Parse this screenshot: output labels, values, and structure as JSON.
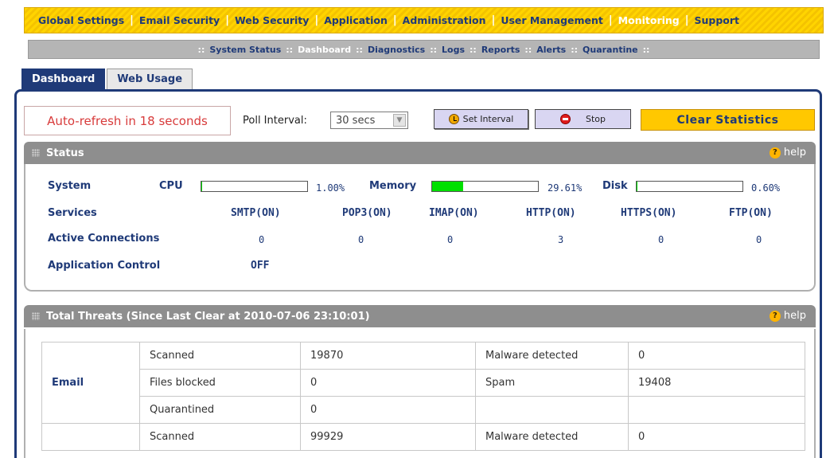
{
  "topnav": {
    "items": [
      "Global Settings",
      "Email Security",
      "Web Security",
      "Application",
      "Administration",
      "User Management",
      "Monitoring",
      "Support"
    ],
    "active_index": 6
  },
  "subnav": {
    "items": [
      "System Status",
      "Dashboard",
      "Diagnostics",
      "Logs",
      "Reports",
      "Alerts",
      "Quarantine"
    ],
    "active_index": 1
  },
  "tabs": [
    "Dashboard",
    "Web Usage"
  ],
  "toolbar": {
    "refresh_text": "Auto-refresh in 18 seconds",
    "poll_label": "Poll Interval:",
    "poll_value": "30 secs",
    "set_interval_label": "Set Interval",
    "stop_label": "Stop",
    "clear_label": "Clear Statistics"
  },
  "status": {
    "title": "Status",
    "help": "help",
    "system_label": "System",
    "cpu_label": "CPU",
    "cpu_value": "1.00%",
    "cpu_fraction": 0.01,
    "memory_label": "Memory",
    "memory_value": "29.61%",
    "memory_fraction": 0.2961,
    "disk_label": "Disk",
    "disk_value": "0.60%",
    "disk_fraction": 0.006,
    "services_label": "Services",
    "services": [
      "SMTP(ON)",
      "POP3(ON)",
      "IMAP(ON)",
      "HTTP(ON)",
      "HTTPS(ON)",
      "FTP(ON)"
    ],
    "connections_label": "Active Connections",
    "connections": [
      "0",
      "0",
      "0",
      "3",
      "0",
      "0"
    ],
    "app_control_label": "Application Control",
    "app_control_value": "OFF"
  },
  "threats": {
    "title": "Total Threats (Since Last Clear at 2010-07-06 23:10:01)",
    "help": "help",
    "email_group": "Email",
    "rows": [
      [
        "Scanned",
        "19870",
        "Malware detected",
        "0"
      ],
      [
        "Files blocked",
        "0",
        "Spam",
        "19408"
      ],
      [
        "Quarantined",
        "0",
        "",
        ""
      ],
      [
        "Scanned",
        "99929",
        "Malware detected",
        "0"
      ]
    ]
  },
  "colors": {
    "nav_yellow": "#ffd400",
    "navy": "#1f3a78",
    "header_gray": "#8e8e8e",
    "bar_green": "#00e000",
    "alert_red": "#d83b3b"
  }
}
